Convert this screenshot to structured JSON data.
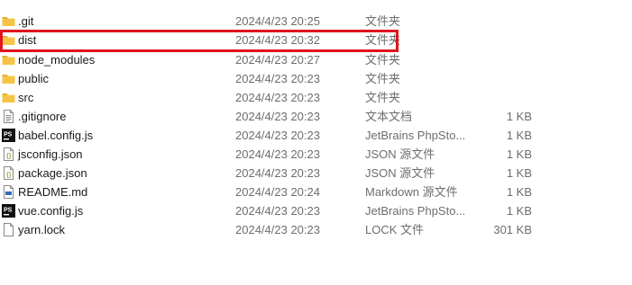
{
  "files": [
    {
      "name": ".git",
      "date": "2024/4/23 20:25",
      "type": "文件夹",
      "size": "",
      "icon": "folder-icon"
    },
    {
      "name": "dist",
      "date": "2024/4/23 20:32",
      "type": "文件夹",
      "size": "",
      "icon": "folder-icon"
    },
    {
      "name": "node_modules",
      "date": "2024/4/23 20:27",
      "type": "文件夹",
      "size": "",
      "icon": "folder-icon"
    },
    {
      "name": "public",
      "date": "2024/4/23 20:23",
      "type": "文件夹",
      "size": "",
      "icon": "folder-icon"
    },
    {
      "name": "src",
      "date": "2024/4/23 20:23",
      "type": "文件夹",
      "size": "",
      "icon": "folder-icon"
    },
    {
      "name": ".gitignore",
      "date": "2024/4/23 20:23",
      "type": "文本文档",
      "size": "1 KB",
      "icon": "text-file-icon"
    },
    {
      "name": "babel.config.js",
      "date": "2024/4/23 20:23",
      "type": "JetBrains PhpSto...",
      "size": "1 KB",
      "icon": "phpstorm-file-icon"
    },
    {
      "name": "jsconfig.json",
      "date": "2024/4/23 20:23",
      "type": "JSON 源文件",
      "size": "1 KB",
      "icon": "json-file-icon"
    },
    {
      "name": "package.json",
      "date": "2024/4/23 20:23",
      "type": "JSON 源文件",
      "size": "1 KB",
      "icon": "json-file-icon"
    },
    {
      "name": "README.md",
      "date": "2024/4/23 20:24",
      "type": "Markdown 源文件",
      "size": "1 KB",
      "icon": "markdown-file-icon"
    },
    {
      "name": "vue.config.js",
      "date": "2024/4/23 20:23",
      "type": "JetBrains PhpSto...",
      "size": "1 KB",
      "icon": "phpstorm-file-icon"
    },
    {
      "name": "yarn.lock",
      "date": "2024/4/23 20:23",
      "type": "LOCK 文件",
      "size": "301 KB",
      "icon": "blank-file-icon"
    }
  ],
  "highlighted_index": 1,
  "colors": {
    "highlight_border": "#e0141e",
    "folder": "#f6c445",
    "folder_tab": "#e3a928",
    "phpstorm_bg": "#111111",
    "json_accent": "#9aa84a",
    "markdown_accent": "#2f6fb5"
  }
}
